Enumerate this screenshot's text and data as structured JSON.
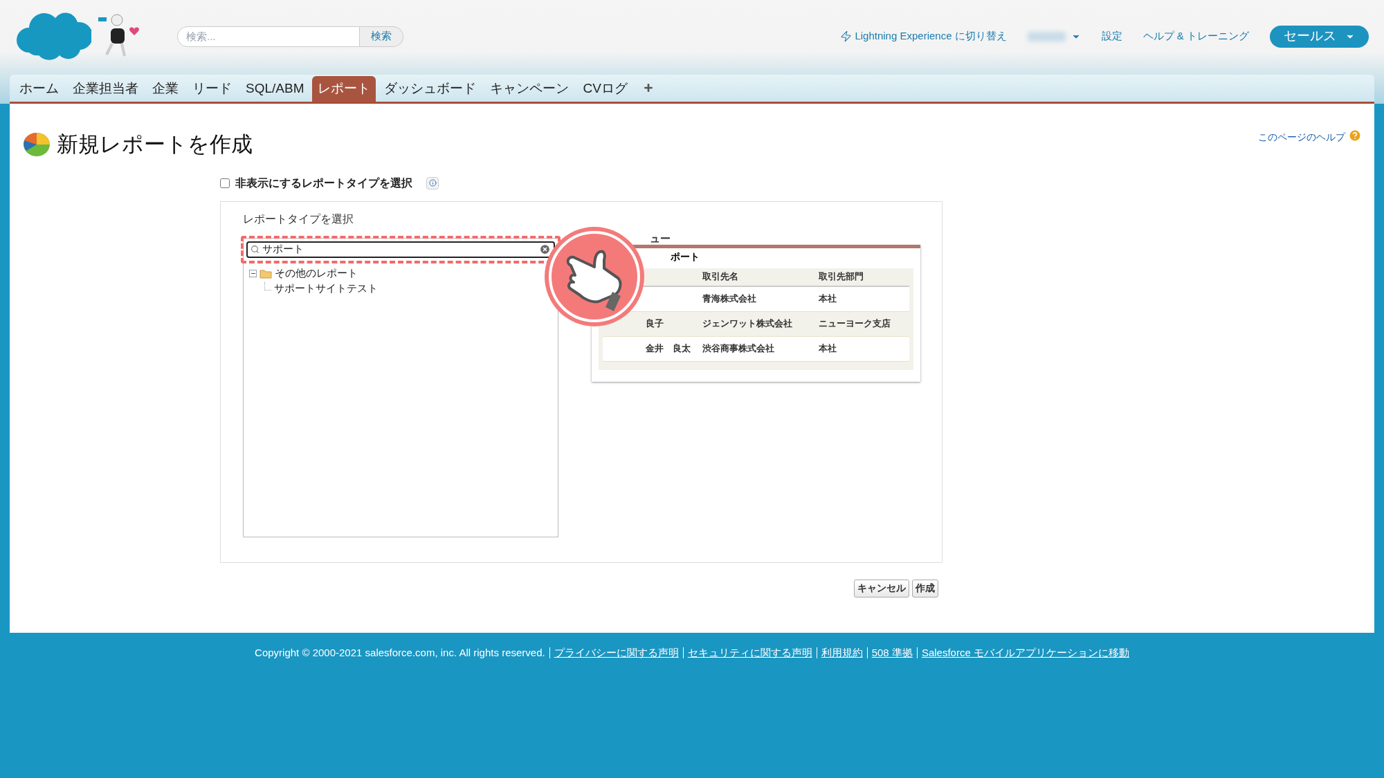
{
  "header": {
    "search": {
      "placeholder": "検索...",
      "button": "検索"
    },
    "lightning_link": "Lightning Experience に切り替え",
    "links": [
      "設定",
      "ヘルプ & トレーニング"
    ],
    "app_menu": "セールス"
  },
  "tabs": [
    {
      "label": "ホーム",
      "selected": false
    },
    {
      "label": "企業担当者",
      "selected": false
    },
    {
      "label": "企業",
      "selected": false
    },
    {
      "label": "リード",
      "selected": false
    },
    {
      "label": "SQL/ABM",
      "selected": false
    },
    {
      "label": "レポート",
      "selected": true
    },
    {
      "label": "ダッシュボード",
      "selected": false
    },
    {
      "label": "キャンペーン",
      "selected": false
    },
    {
      "label": "CVログ",
      "selected": false
    }
  ],
  "page": {
    "title": "新規レポートを作成",
    "help_link": "このページのヘルプ",
    "hidden_types": {
      "label": "非表示にするレポートタイプを選択",
      "checked": false
    },
    "picker": {
      "label": "レポートタイプを選択",
      "search_value": "サポート",
      "tree": [
        {
          "label": "その他のレポート",
          "expanded": true,
          "children": [
            {
              "label": "サポートサイトテスト"
            }
          ]
        }
      ]
    },
    "preview": {
      "label": "ュー",
      "report_title": "ポート",
      "columns": [
        "取引先名",
        "取引先部門"
      ],
      "rows": [
        {
          "cells": [
            "青海株式会社",
            "本社"
          ]
        },
        {
          "name": "良子",
          "cells": [
            "ジェンワット株式会社",
            "ニューヨーク支店"
          ]
        },
        {
          "name": "金井　良太",
          "cells": [
            "渋谷商事株式会社",
            "本社"
          ]
        }
      ]
    },
    "buttons": [
      "キャンセル",
      "作成"
    ]
  },
  "footer": {
    "copyright": "Copyright © 2000-2021 salesforce.com, inc. All rights reserved.",
    "links": [
      "プライバシーに関する声明",
      "セキュリティに関する声明",
      "利用規約",
      "508 準拠",
      "Salesforce モバイルアプリケーションに移動"
    ]
  }
}
